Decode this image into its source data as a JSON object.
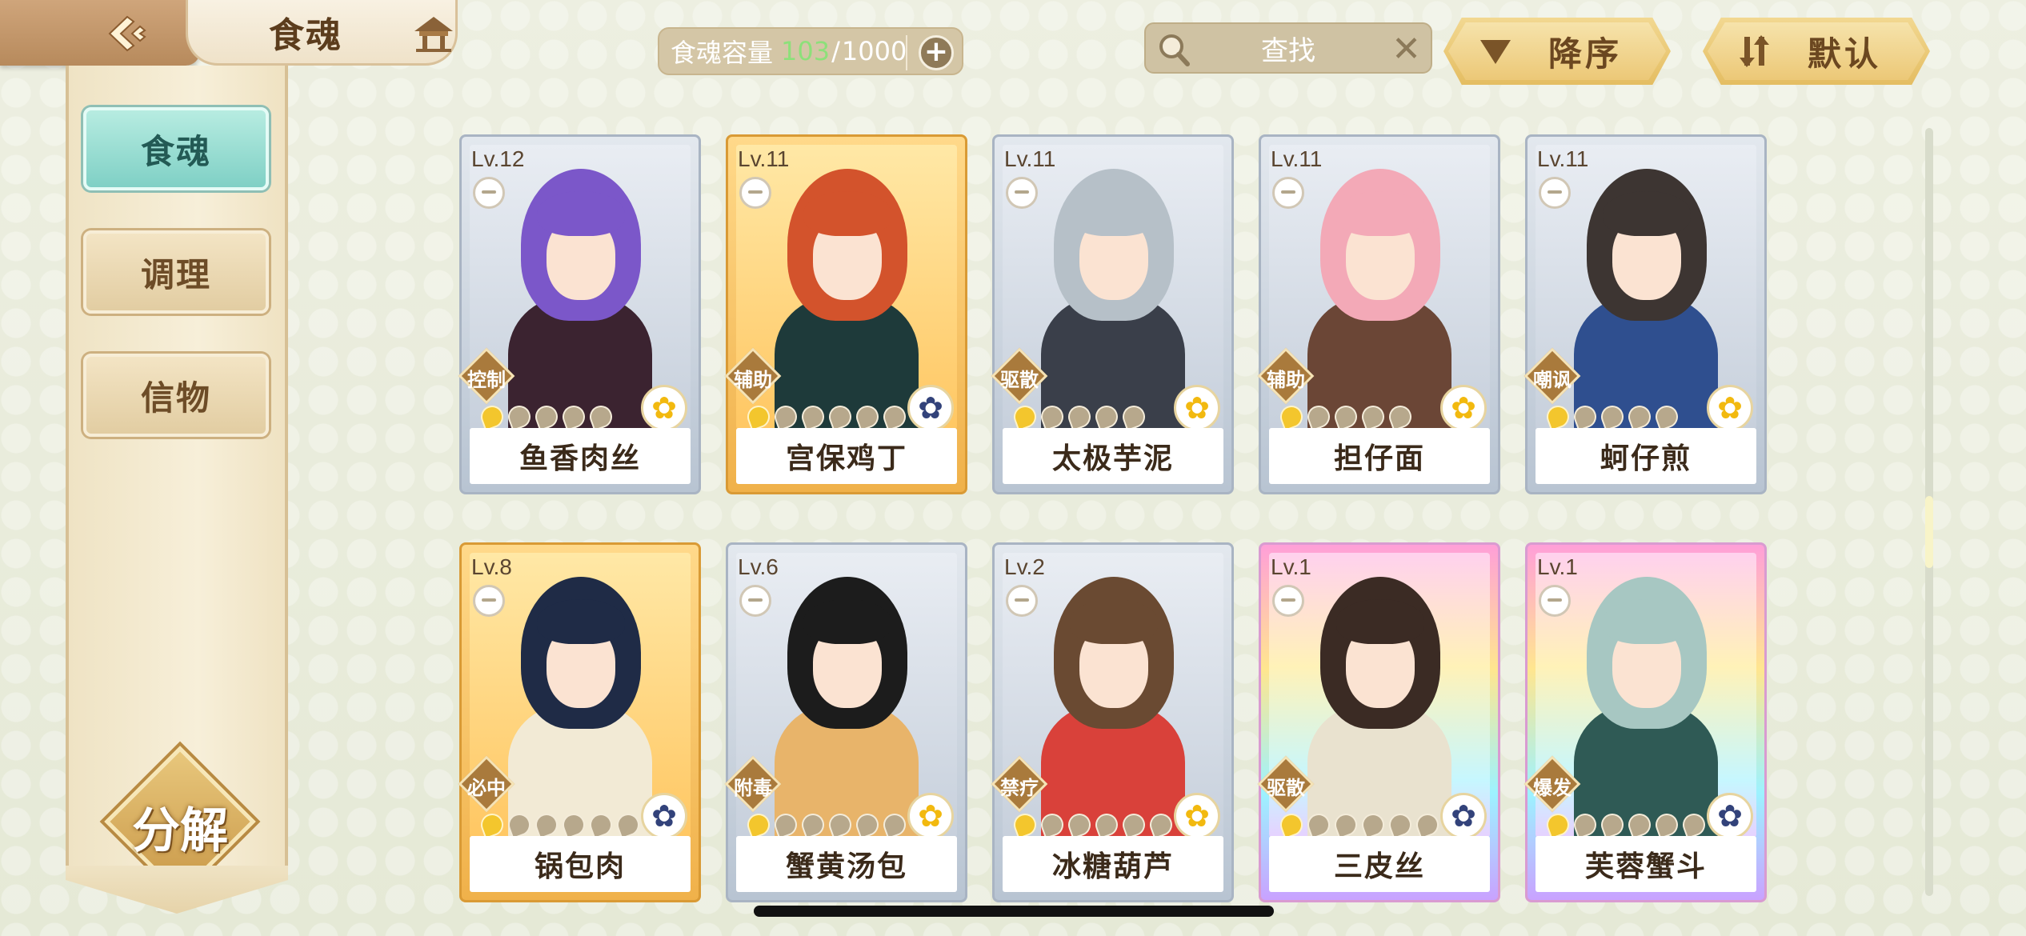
{
  "header": {
    "title": "食魂",
    "capacity_label": "食魂容量",
    "capacity_current": "103",
    "capacity_max": "1000",
    "search_placeholder": "查找",
    "sort_order_label": "降序",
    "sort_mode_label": "默认"
  },
  "sidebar": {
    "items": [
      {
        "label": "食魂",
        "active": true
      },
      {
        "label": "调理",
        "active": false
      },
      {
        "label": "信物",
        "active": false
      }
    ],
    "decompose_label": "分解"
  },
  "cards": [
    {
      "level": "Lv.12",
      "name": "鱼香肉丝",
      "role": "控制",
      "frame": "silver",
      "stars_on": 1,
      "stars_total": 5,
      "flower": "gold",
      "hair": "#7b57c9",
      "outfit": "#3b2330"
    },
    {
      "level": "Lv.11",
      "name": "宫保鸡丁",
      "role": "辅助",
      "frame": "gold",
      "stars_on": 1,
      "stars_total": 6,
      "flower": "navy",
      "hair": "#d3532c",
      "outfit": "#1e3a3a"
    },
    {
      "level": "Lv.11",
      "name": "太极芋泥",
      "role": "驱散",
      "frame": "silver",
      "stars_on": 1,
      "stars_total": 5,
      "flower": "gold",
      "hair": "#b6c0c8",
      "outfit": "#3a3f4a"
    },
    {
      "level": "Lv.11",
      "name": "担仔面",
      "role": "辅助",
      "frame": "silver",
      "stars_on": 1,
      "stars_total": 5,
      "flower": "gold",
      "hair": "#f3a9b7",
      "outfit": "#6b4636"
    },
    {
      "level": "Lv.11",
      "name": "蚵仔煎",
      "role": "嘲讽",
      "frame": "silver",
      "stars_on": 1,
      "stars_total": 5,
      "flower": "gold",
      "hair": "#3d3532",
      "outfit": "#2f4f8f"
    },
    {
      "level": "Lv.8",
      "name": "锅包肉",
      "role": "必中",
      "frame": "gold",
      "stars_on": 1,
      "stars_total": 6,
      "flower": "navy",
      "hair": "#1f2b46",
      "outfit": "#f2ead5"
    },
    {
      "level": "Lv.6",
      "name": "蟹黄汤包",
      "role": "附毒",
      "frame": "silver",
      "stars_on": 1,
      "stars_total": 6,
      "flower": "gold",
      "hair": "#1c1c1c",
      "outfit": "#e8b46a"
    },
    {
      "level": "Lv.2",
      "name": "冰糖葫芦",
      "role": "禁疗",
      "frame": "silver",
      "stars_on": 1,
      "stars_total": 6,
      "flower": "gold",
      "hair": "#6a4a32",
      "outfit": "#d9413a"
    },
    {
      "level": "Lv.1",
      "name": "三皮丝",
      "role": "驱散",
      "frame": "rainbow",
      "stars_on": 1,
      "stars_total": 6,
      "flower": "navy",
      "hair": "#3b2b24",
      "outfit": "#e9e2cf"
    },
    {
      "level": "Lv.1",
      "name": "芙蓉蟹斗",
      "role": "爆发",
      "frame": "rainbow",
      "stars_on": 1,
      "stars_total": 6,
      "flower": "navy",
      "hair": "#a7c7c2",
      "outfit": "#2f5a55"
    }
  ]
}
